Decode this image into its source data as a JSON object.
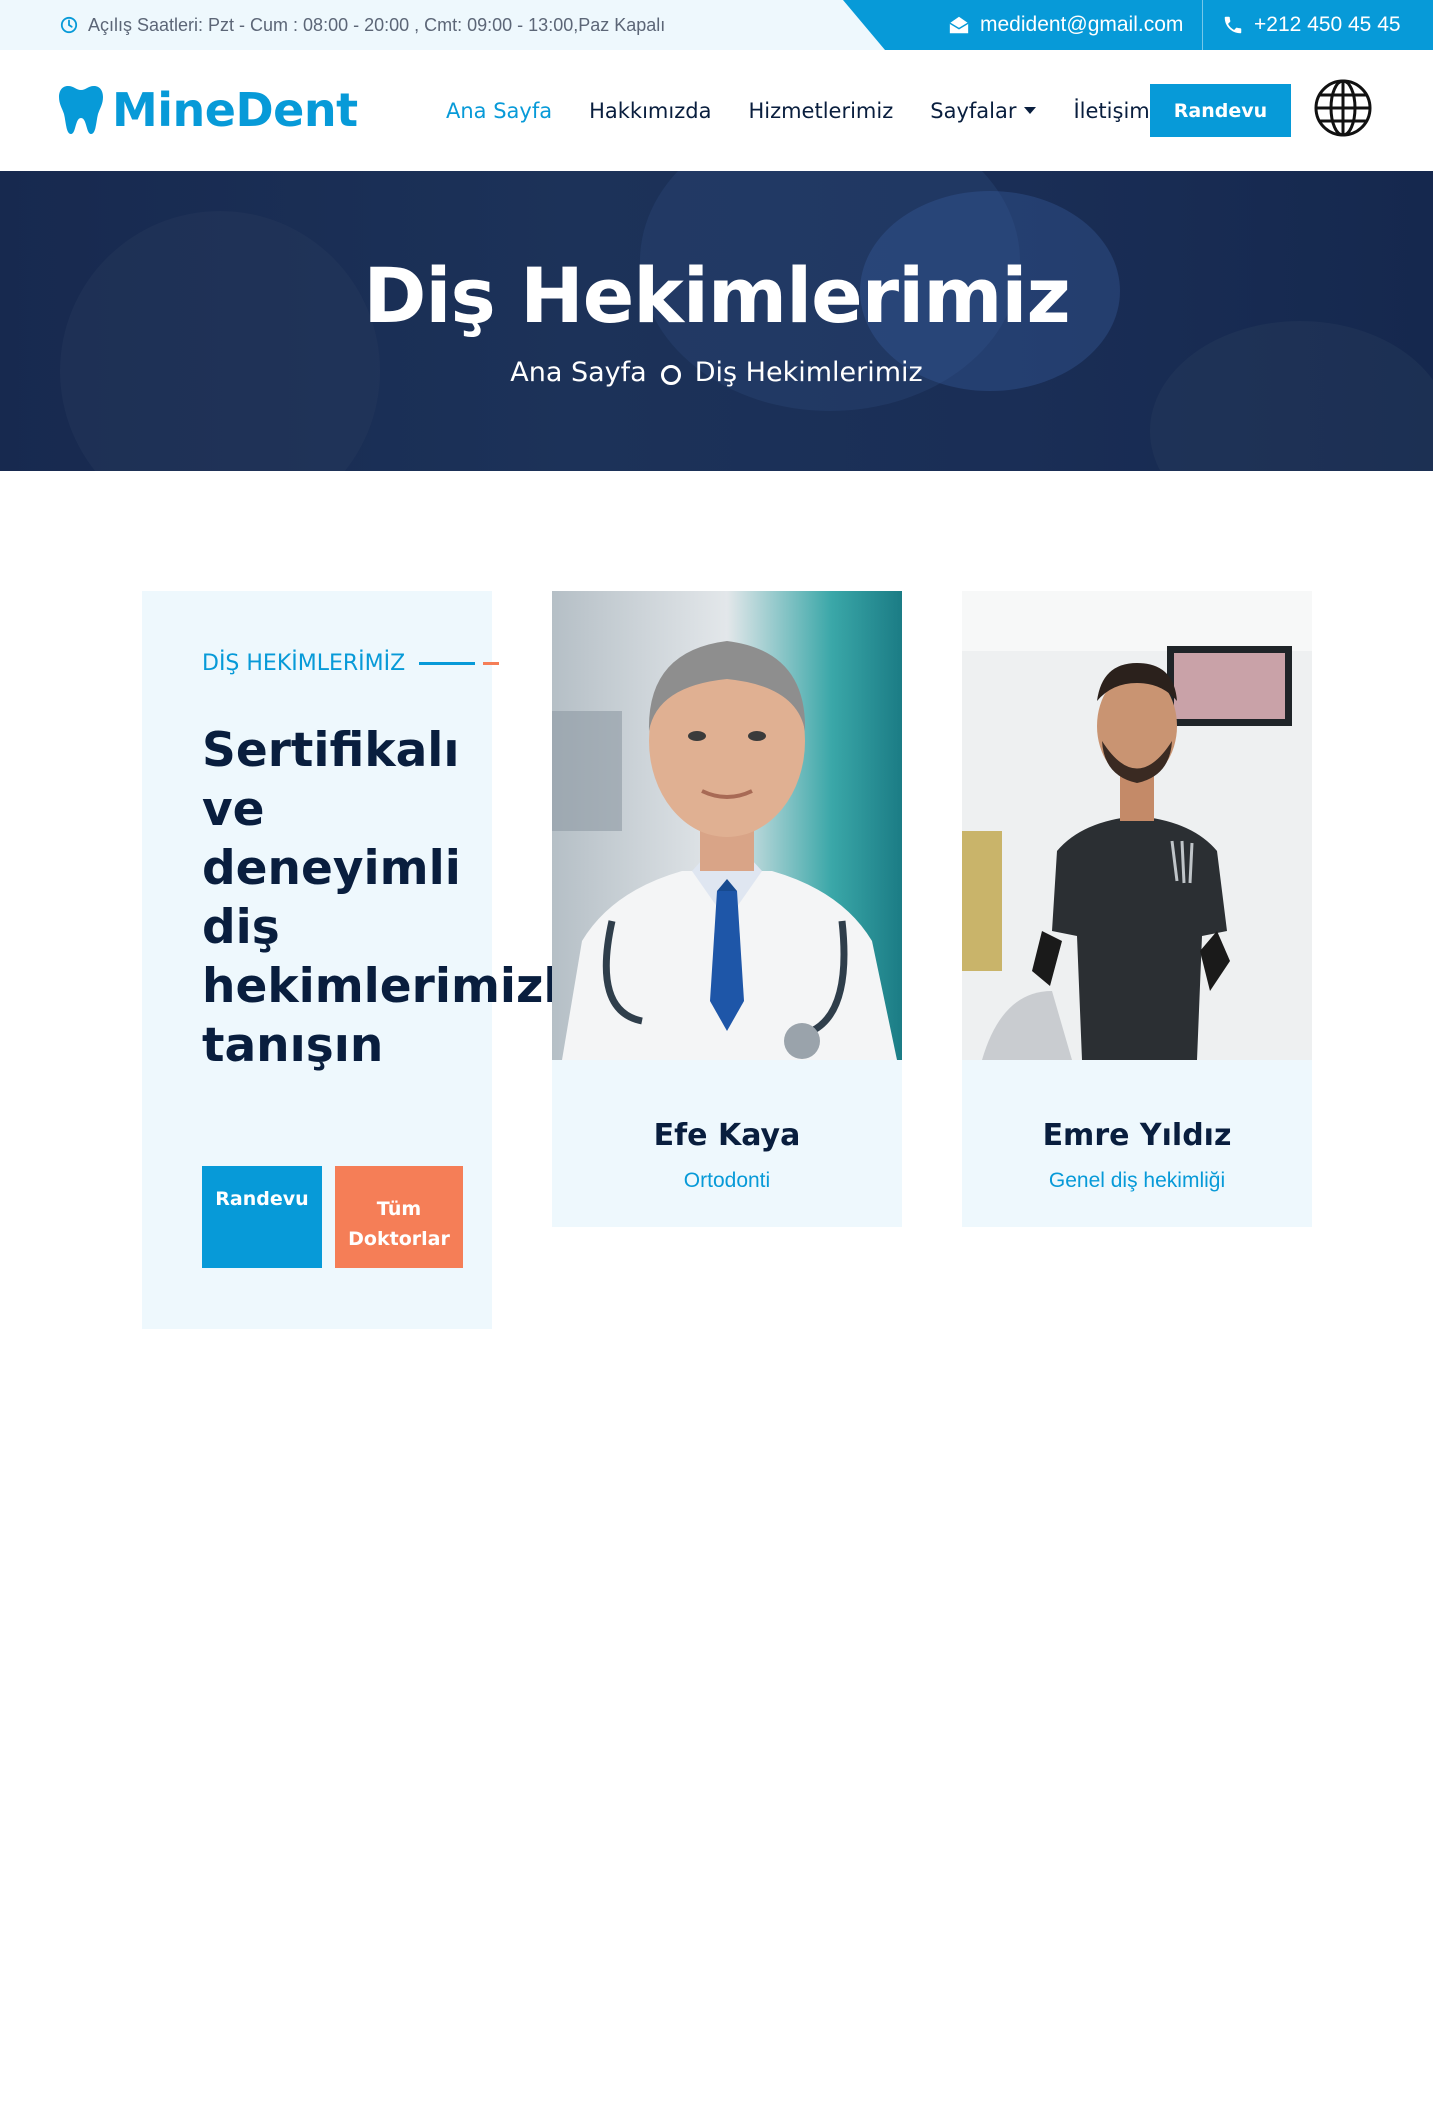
{
  "topbar": {
    "hours": "Açılış Saatleri: Pzt - Cum : 08:00 - 20:00 , Cmt: 09:00 - 13:00,Paz Kapalı",
    "email": "medident@gmail.com",
    "phone": "+212 450 45 45"
  },
  "brand": {
    "name": "MineDent",
    "color": "#079ad8"
  },
  "nav": {
    "items": [
      "Ana Sayfa",
      "Hakkımızda",
      "Hizmetlerimiz",
      "Sayfalar",
      "İletişim"
    ],
    "active_index": 0,
    "cta": "Randevu"
  },
  "hero": {
    "title": "Diş Hekimlerimiz",
    "breadcrumb": [
      "Ana Sayfa",
      "Diş Hekimlerimiz"
    ]
  },
  "intro": {
    "tag": "DİŞ HEKİMLERİMİZ",
    "title_lines": [
      "Sertifikalı",
      "ve",
      "deneyimli",
      "diş",
      "hekimlerimizle",
      "tanışın"
    ],
    "btn_primary": "Randevu",
    "btn_secondary_lines": [
      "Tüm",
      "Doktorlar"
    ]
  },
  "doctors": [
    {
      "name": "Efe Kaya",
      "role": "Ortodonti"
    },
    {
      "name": "Emre Yıldız",
      "role": "Genel diş hekimliği"
    }
  ],
  "colors": {
    "primary": "#079ad8",
    "accent": "#f57e57",
    "dark": "#091e3e",
    "light_bg": "#eef8fd"
  }
}
